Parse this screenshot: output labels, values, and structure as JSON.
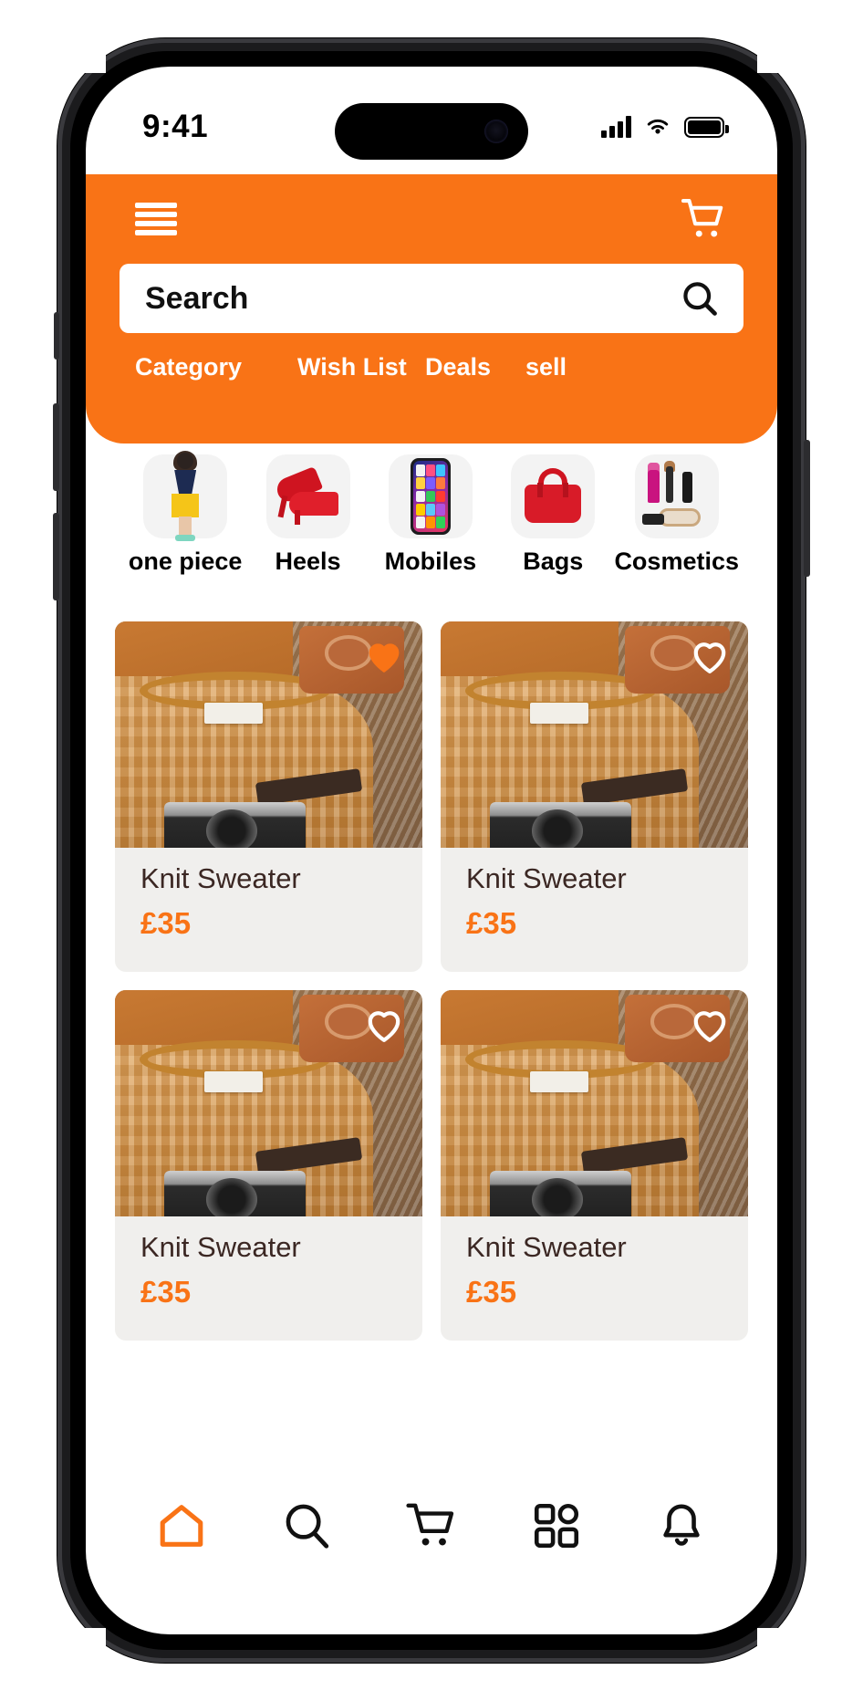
{
  "status_bar": {
    "time": "9:41",
    "icons": [
      "cellular-signal-icon",
      "wifi-icon",
      "battery-icon"
    ]
  },
  "header": {
    "menu_icon": "hamburger-menu-icon",
    "cart_icon": "shopping-cart-icon",
    "search": {
      "placeholder": "Search",
      "value": "",
      "icon": "search-icon"
    },
    "nav_links": [
      {
        "label": "Category"
      },
      {
        "label": "Wish List"
      },
      {
        "label": "Deals"
      },
      {
        "label": "sell"
      }
    ],
    "background_color": "#F97316"
  },
  "categories": [
    {
      "label": "one piece",
      "icon": "dress-icon"
    },
    {
      "label": "Heels",
      "icon": "high-heel-shoes-icon"
    },
    {
      "label": "Mobiles",
      "icon": "smartphone-icon"
    },
    {
      "label": "Bags",
      "icon": "handbag-icon"
    },
    {
      "label": "Cosmetics",
      "icon": "cosmetics-icon"
    }
  ],
  "products": [
    {
      "title": "Knit Sweater",
      "price": "£35",
      "favorited": true,
      "heart_icon": "heart-filled-icon"
    },
    {
      "title": "Knit Sweater",
      "price": "£35",
      "favorited": false,
      "heart_icon": "heart-outline-icon"
    },
    {
      "title": "Knit Sweater",
      "price": "£35",
      "favorited": false,
      "heart_icon": "heart-outline-icon"
    },
    {
      "title": "Knit Sweater",
      "price": "£35",
      "favorited": false,
      "heart_icon": "heart-outline-icon"
    }
  ],
  "bottom_nav": [
    {
      "name": "home",
      "icon": "home-icon",
      "active": true
    },
    {
      "name": "search",
      "icon": "search-icon",
      "active": false
    },
    {
      "name": "cart",
      "icon": "shopping-cart-icon",
      "active": false
    },
    {
      "name": "categories",
      "icon": "grid-icon",
      "active": false
    },
    {
      "name": "notifications",
      "icon": "bell-icon",
      "active": false
    }
  ],
  "colors": {
    "accent": "#F97316",
    "price": "#F97316",
    "title": "#3B2723",
    "card_bg": "#F0EFED"
  }
}
